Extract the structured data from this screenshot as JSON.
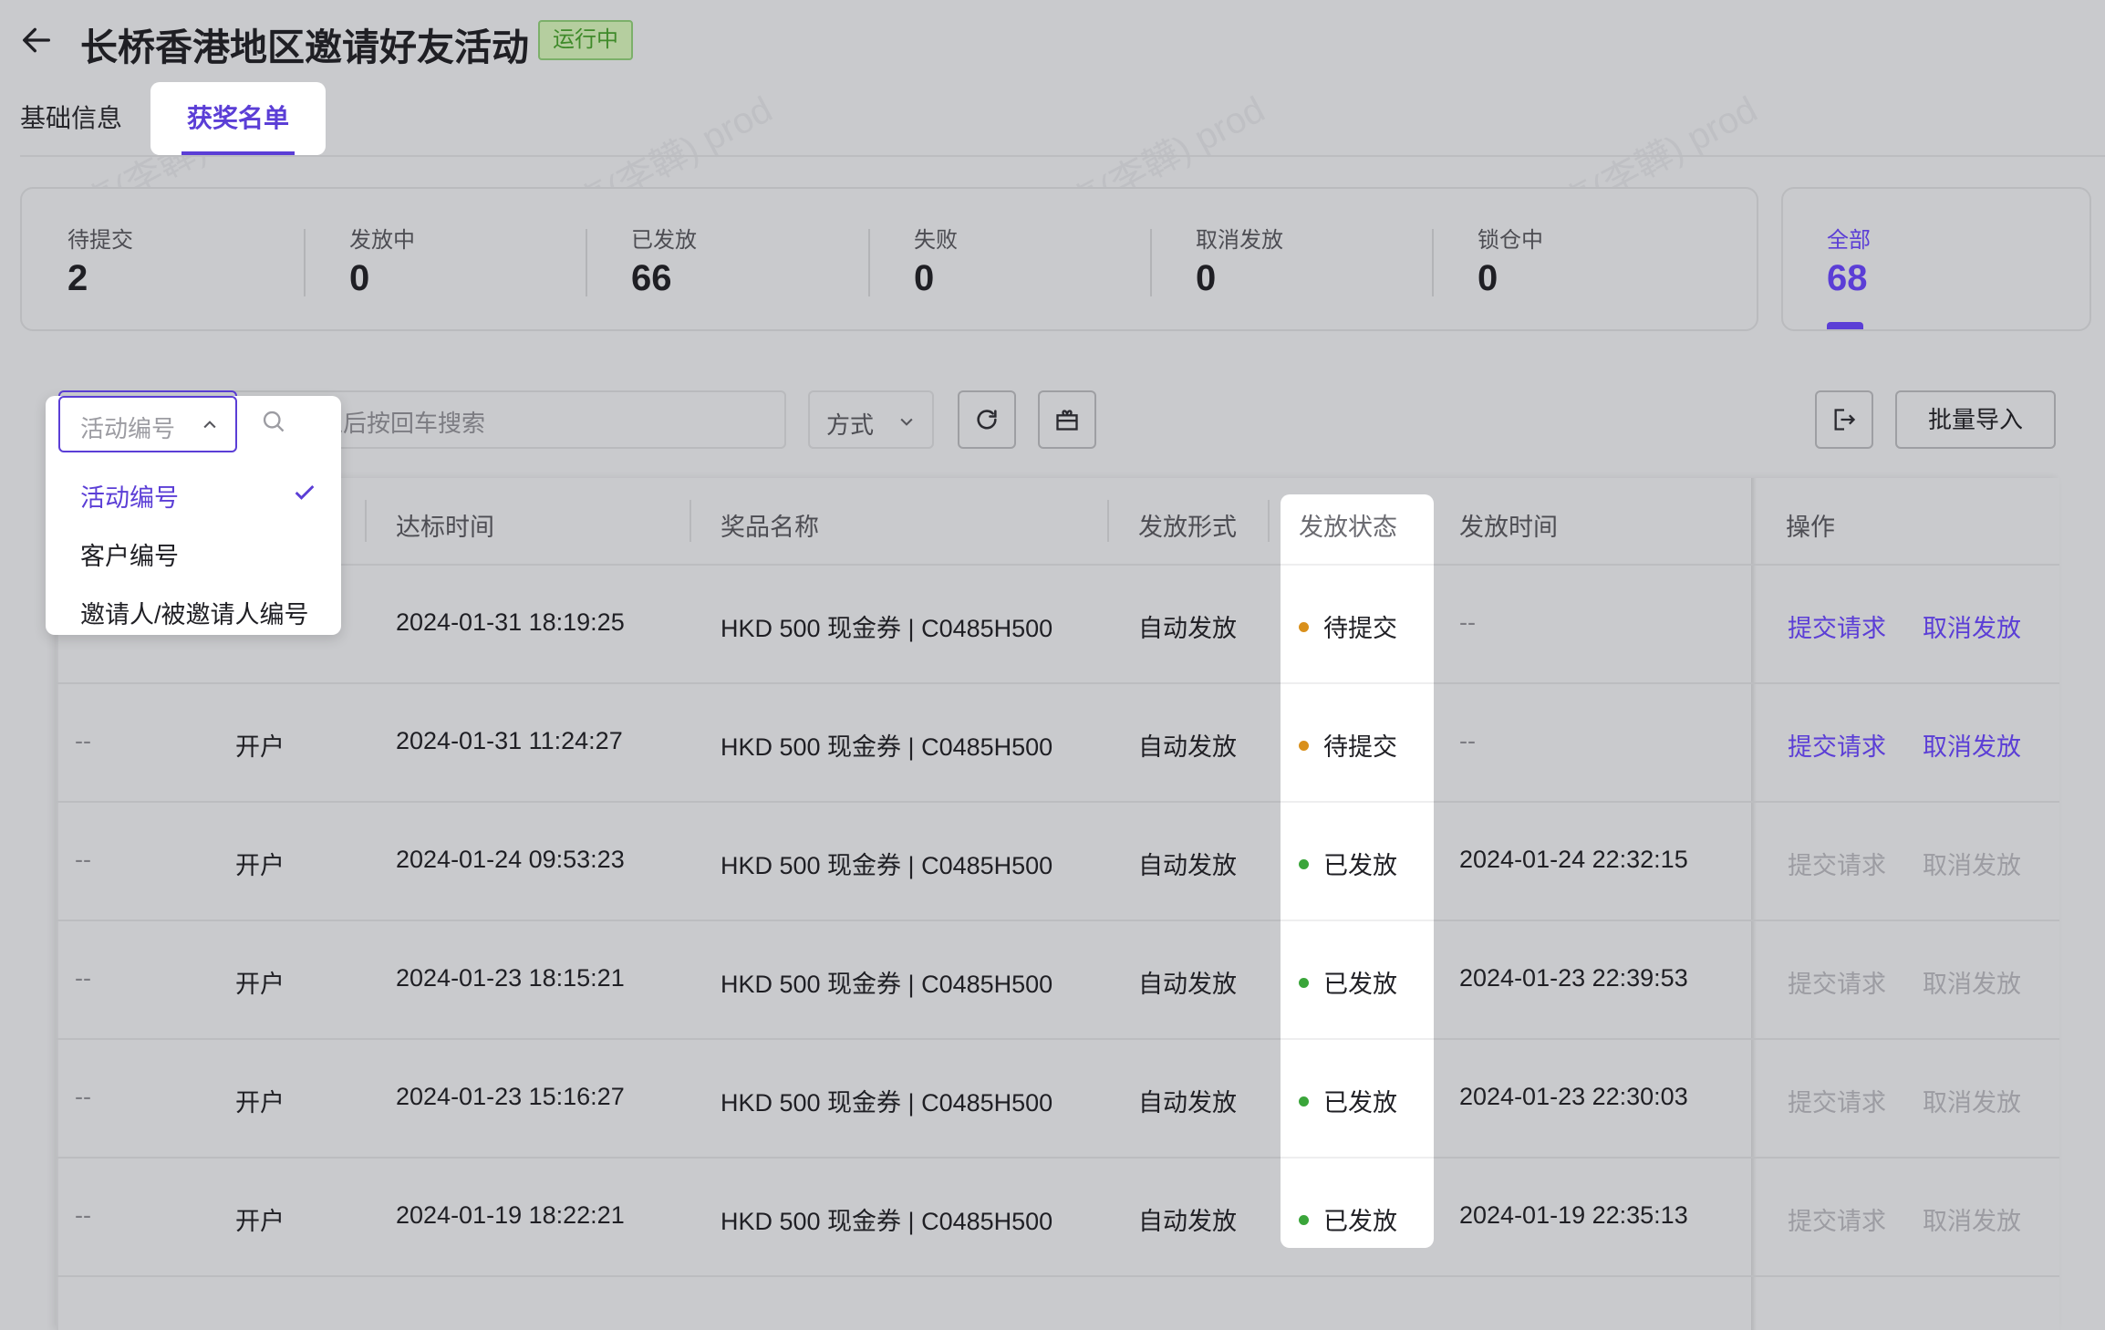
{
  "page": {
    "title": "长桥香港地区邀请好友活动",
    "status_badge": "运行中",
    "back_icon": "arrow-left-icon"
  },
  "tabs": [
    {
      "label": "基础信息",
      "active": false
    },
    {
      "label": "获奖名单",
      "active": true
    }
  ],
  "stats": [
    {
      "label": "待提交",
      "value": "2"
    },
    {
      "label": "发放中",
      "value": "0"
    },
    {
      "label": "已发放",
      "value": "66"
    },
    {
      "label": "失败",
      "value": "0"
    },
    {
      "label": "取消发放",
      "value": "0"
    },
    {
      "label": "锁仓中",
      "value": "0"
    }
  ],
  "stat_all": {
    "label": "全部",
    "value": "68"
  },
  "toolbar": {
    "search_field_select": "活动编号",
    "search_placeholder": "输入后按回车搜索",
    "method_select": "方式",
    "import_label": "批量导入"
  },
  "dropdown": {
    "options": [
      "活动编号",
      "客户编号",
      "邀请人/被邀请人编号"
    ],
    "selected": "活动编号"
  },
  "table": {
    "headers": {
      "reached_time": "达标时间",
      "prize_name": "奖品名称",
      "issue_form": "发放形式",
      "issue_status": "发放状态",
      "issue_time": "发放时间",
      "actions": "操作"
    },
    "action_submit": "提交请求",
    "action_cancel": "取消发放",
    "rows": [
      {
        "col1": "",
        "type": "",
        "reached_time": "2024-01-31 18:19:25",
        "prize": "HKD 500 现金券 | C0485H500",
        "form": "自动发放",
        "status": "待提交",
        "issue_time": "--"
      },
      {
        "col1": "--",
        "type": "开户",
        "reached_time": "2024-01-31 11:24:27",
        "prize": "HKD 500 现金券 | C0485H500",
        "form": "自动发放",
        "status": "待提交",
        "issue_time": "--"
      },
      {
        "col1": "--",
        "type": "开户",
        "reached_time": "2024-01-24 09:53:23",
        "prize": "HKD 500 现金券 | C0485H500",
        "form": "自动发放",
        "status": "已发放",
        "issue_time": "2024-01-24 22:32:15"
      },
      {
        "col1": "--",
        "type": "开户",
        "reached_time": "2024-01-23 18:15:21",
        "prize": "HKD 500 现金券 | C0485H500",
        "form": "自动发放",
        "status": "已发放",
        "issue_time": "2024-01-23 22:39:53"
      },
      {
        "col1": "--",
        "type": "开户",
        "reached_time": "2024-01-23 15:16:27",
        "prize": "HKD 500 现金券 | C0485H500",
        "form": "自动发放",
        "status": "已发放",
        "issue_time": "2024-01-23 22:30:03"
      },
      {
        "col1": "--",
        "type": "开户",
        "reached_time": "2024-01-19 18:22:21",
        "prize": "HKD 500 现金券 | C0485H500",
        "form": "自动发放",
        "status": "已发放",
        "issue_time": "2024-01-19 22:35:13"
      }
    ]
  },
  "colors": {
    "accent": "#5b3ed6",
    "pending_dot": "#d9901c",
    "issued_dot": "#3aa53a",
    "badge_green": "#3f8a2a"
  }
}
